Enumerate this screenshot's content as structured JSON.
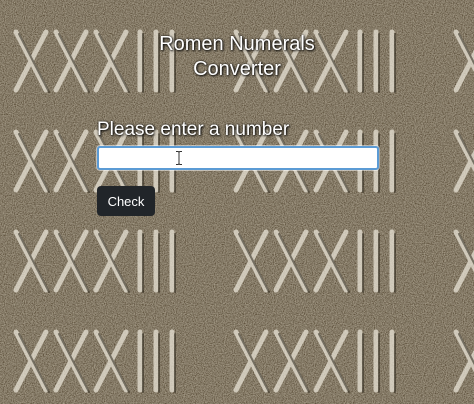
{
  "app": {
    "title_line1": "Romen Numerals",
    "title_line2": "Converter"
  },
  "form": {
    "prompt_label": "Please enter a number",
    "input_value": "",
    "input_placeholder": "",
    "check_label": "Check"
  },
  "background": {
    "motif": "XXXIII",
    "stone_color": "#6b5d45",
    "carving_color": "#d9d4c8"
  },
  "icons": {
    "cursor": "text-cursor-icon"
  }
}
